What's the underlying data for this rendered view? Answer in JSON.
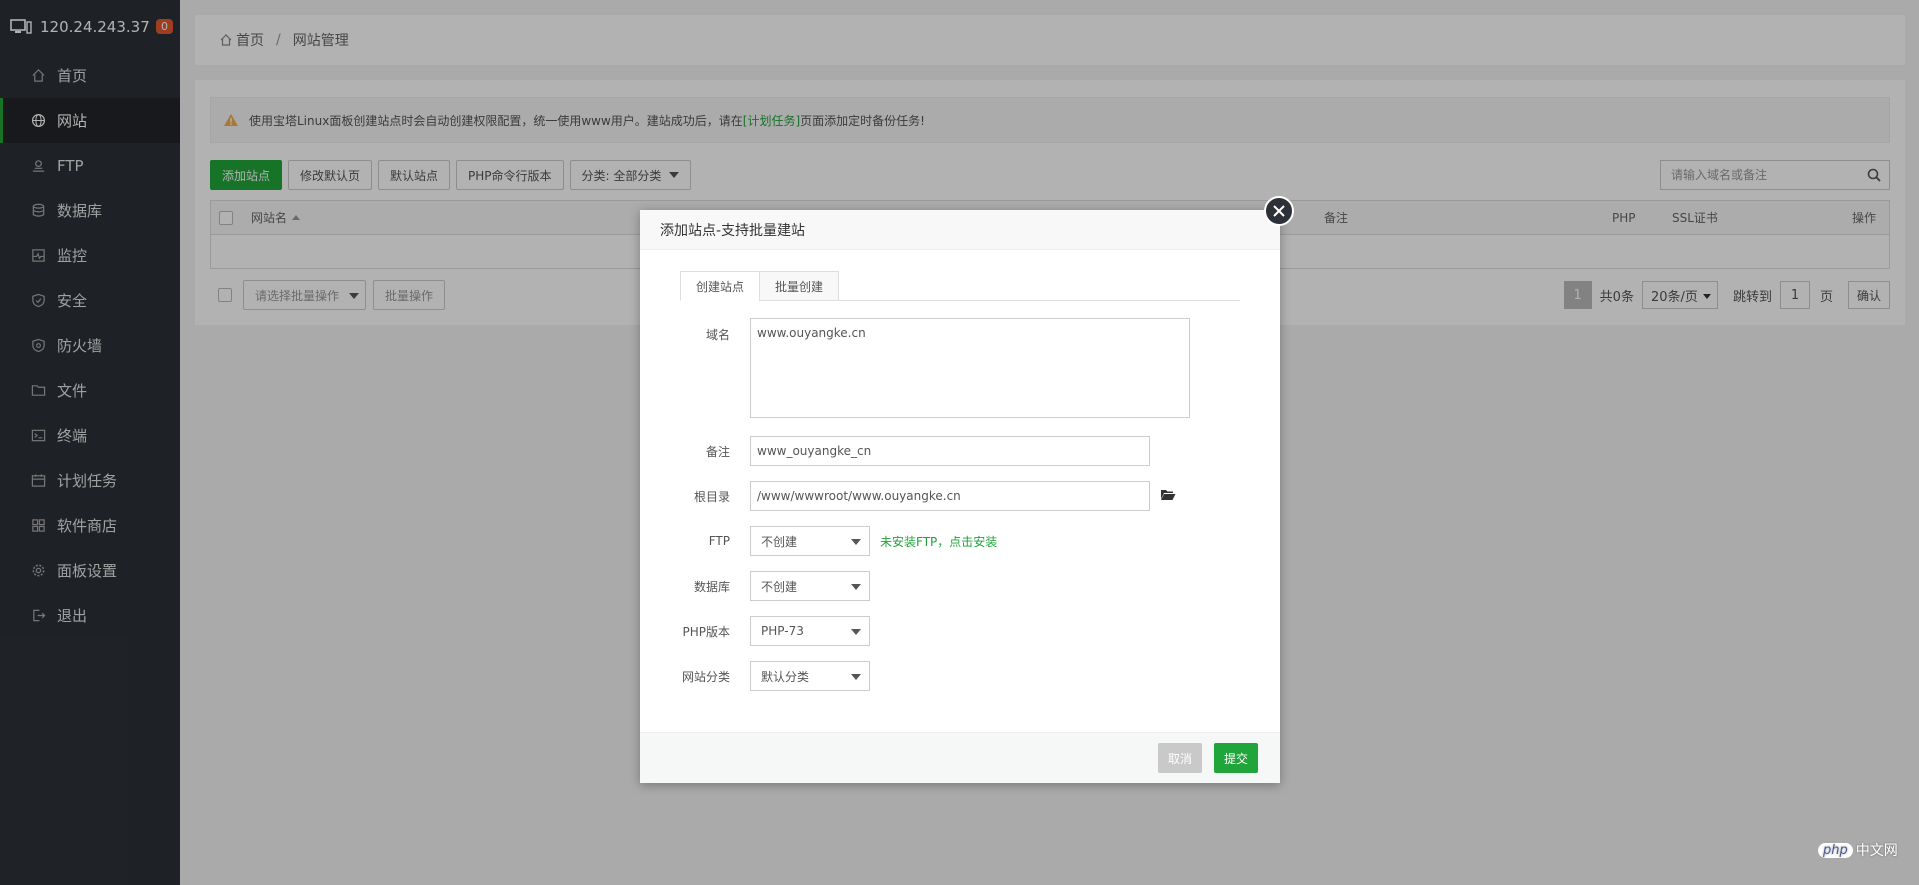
{
  "sidebar": {
    "server_ip": "120.24.243.37",
    "badge_count": "0",
    "items": [
      {
        "label": "首页",
        "icon": "home-icon"
      },
      {
        "label": "网站",
        "icon": "globe-icon"
      },
      {
        "label": "FTP",
        "icon": "ftp-icon"
      },
      {
        "label": "数据库",
        "icon": "database-icon"
      },
      {
        "label": "监控",
        "icon": "monitor-icon"
      },
      {
        "label": "安全",
        "icon": "shield-icon"
      },
      {
        "label": "防火墙",
        "icon": "firewall-icon"
      },
      {
        "label": "文件",
        "icon": "folder-icon"
      },
      {
        "label": "终端",
        "icon": "terminal-icon"
      },
      {
        "label": "计划任务",
        "icon": "calendar-icon"
      },
      {
        "label": "软件商店",
        "icon": "apps-icon"
      },
      {
        "label": "面板设置",
        "icon": "gear-icon"
      },
      {
        "label": "退出",
        "icon": "logout-icon"
      }
    ],
    "active_index": 1
  },
  "breadcrumb": {
    "home": "首页",
    "separator": "/",
    "current": "网站管理"
  },
  "notice": {
    "text_before": "使用宝塔Linux面板创建站点时会自动创建权限配置，统一使用www用户。建站成功后，请在",
    "link": "[计划任务]",
    "text_after": "页面添加定时备份任务!"
  },
  "toolbar": {
    "add_site": "添加站点",
    "edit_default_page": "修改默认页",
    "default_site": "默认站点",
    "php_cli_version": "PHP命令行版本",
    "category": "分类: 全部分类"
  },
  "search": {
    "placeholder": "请输入域名或备注"
  },
  "table": {
    "columns": {
      "name": "网站名",
      "remark": "备注",
      "php": "PHP",
      "ssl": "SSL证书",
      "actions": "操作"
    }
  },
  "bulk": {
    "select_placeholder": "请选择批量操作",
    "action": "批量操作"
  },
  "pagination": {
    "current_page": "1",
    "total": "共0条",
    "per_page": "20条/页",
    "goto_label": "跳转到",
    "goto_value": "1",
    "page_unit": "页",
    "confirm": "确认"
  },
  "modal": {
    "title": "添加站点-支持批量建站",
    "tabs": [
      "创建站点",
      "批量创建"
    ],
    "active_tab": 0,
    "domain_label": "域名",
    "domain_value": "www.ouyangke.cn",
    "remark_label": "备注",
    "remark_value": "www_ouyangke_cn",
    "root_label": "根目录",
    "root_value": "/www/wwwroot/www.ouyangke.cn",
    "ftp_label": "FTP",
    "ftp_value": "不创建",
    "ftp_hint": "未安装FTP，点击安装",
    "db_label": "数据库",
    "db_value": "不创建",
    "php_label": "PHP版本",
    "php_value": "PHP-73",
    "category_label": "网站分类",
    "category_value": "默认分类",
    "cancel": "取消",
    "submit": "提交"
  },
  "watermark": {
    "logo_text": "php",
    "site_text": "中文网"
  },
  "colors": {
    "accent": "#20a53a",
    "sidebar_bg": "#2c3138",
    "badge": "#e4582f"
  }
}
